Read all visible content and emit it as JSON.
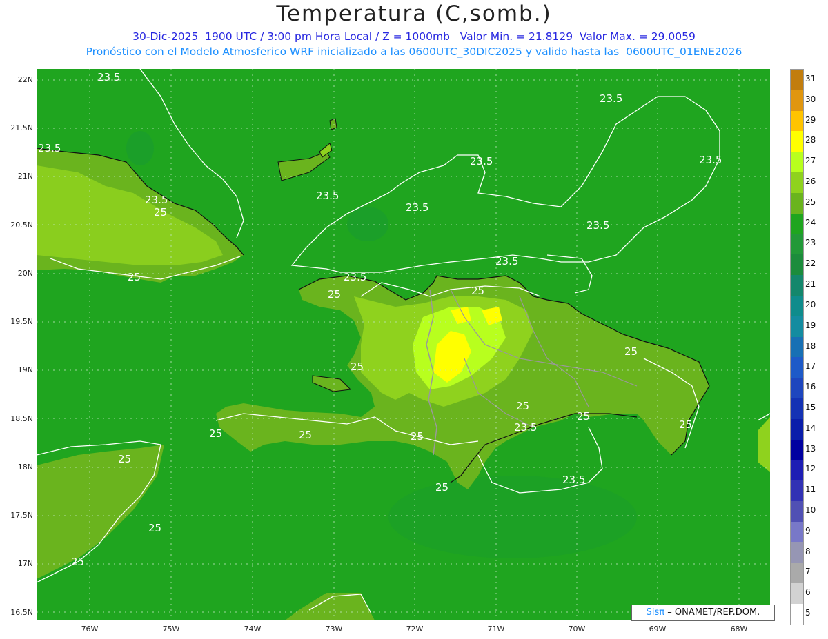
{
  "title": "Temperatura (C,somb.)",
  "subtitle_line1": "30-Dic-2025  1900 UTC / 3:00 pm Hora Local / Z = 1000mb   Valor Min. = 21.8129  Valor Max. = 29.0059",
  "subtitle_line2": "Pronóstico con el Modelo Atmosferico WRF inicializado a las 0600UTC_30DIC2025 y valido hasta las  0600UTC_01ENE2026",
  "lat_labels": [
    "22N",
    "21.5N",
    "21N",
    "20.5N",
    "20N",
    "19.5N",
    "19N",
    "18.5N",
    "18N",
    "17.5N",
    "17N",
    "16.5N"
  ],
  "lon_labels": [
    "76W",
    "75W",
    "74W",
    "73W",
    "72W",
    "71W",
    "70W",
    "69W",
    "68W"
  ],
  "contour_labels": [
    "23.5",
    "25"
  ],
  "colorbar": {
    "labels": [
      "31",
      "30",
      "29",
      "28",
      "27",
      "26",
      "25",
      "24",
      "23",
      "22",
      "21",
      "20",
      "19",
      "18",
      "17",
      "16",
      "15",
      "14",
      "13",
      "12",
      "11",
      "10",
      "9",
      "8",
      "7",
      "6",
      "5"
    ],
    "colors": [
      "#c27d0e",
      "#e0960f",
      "#ffc400",
      "#ffff00",
      "#b8ff1e",
      "#8fd21e",
      "#6ab41e",
      "#1fa51f",
      "#229938",
      "#1c8c3c",
      "#14876c",
      "#0f8c8c",
      "#148ca0",
      "#1870b4",
      "#1e5ac8",
      "#1e46be",
      "#1432b4",
      "#0a1eaa",
      "#0000a0",
      "#1e1eb4",
      "#3232b4",
      "#5050b4",
      "#7878c8",
      "#9696b4",
      "#aaaaaa",
      "#d2d2d2",
      "#ffffff"
    ]
  },
  "credit": {
    "sis": "Sisπ",
    "org": "– ONAMET/REP.DOM."
  }
}
